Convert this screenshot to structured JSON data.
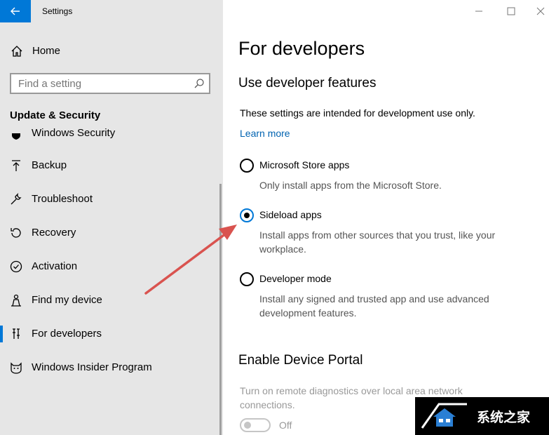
{
  "window": {
    "title": "Settings"
  },
  "sidebar": {
    "home_label": "Home",
    "search_placeholder": "Find a setting",
    "section_title": "Update & Security",
    "items": [
      {
        "label": "Windows Security",
        "icon": "shield-icon"
      },
      {
        "label": "Backup",
        "icon": "backup-icon"
      },
      {
        "label": "Troubleshoot",
        "icon": "wrench-icon"
      },
      {
        "label": "Recovery",
        "icon": "recovery-icon"
      },
      {
        "label": "Activation",
        "icon": "check-circle-icon"
      },
      {
        "label": "Find my device",
        "icon": "person-location-icon"
      },
      {
        "label": "For developers",
        "icon": "developer-tools-icon",
        "selected": true
      },
      {
        "label": "Windows Insider Program",
        "icon": "insider-cat-icon"
      }
    ]
  },
  "main": {
    "page_title": "For developers",
    "section1_title": "Use developer features",
    "description": "These settings are intended for development use only.",
    "learn_more": "Learn more",
    "options": [
      {
        "label": "Microsoft Store apps",
        "description": "Only install apps from the Microsoft Store.",
        "selected": false
      },
      {
        "label": "Sideload apps",
        "description": "Install apps from other sources that you trust, like your workplace.",
        "selected": true
      },
      {
        "label": "Developer mode",
        "description": "Install any signed and trusted app and use advanced development features.",
        "selected": false
      }
    ],
    "section2_title": "Enable Device Portal",
    "portal_description": "Turn on remote diagnostics over local area network connections.",
    "portal_toggle_label": "Off",
    "portal_toggle_on": false
  },
  "watermark": {
    "text": "系统之家"
  },
  "colors": {
    "accent": "#0078d7",
    "sidebar_bg": "#e6e6e6",
    "link": "#0063b1",
    "arrow": "#d9534f"
  }
}
